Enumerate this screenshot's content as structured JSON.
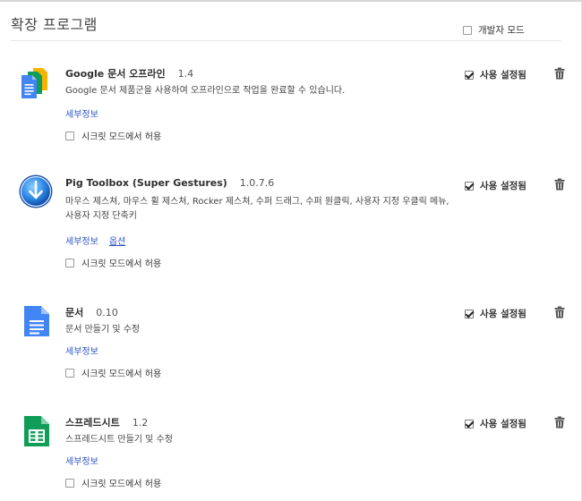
{
  "page": {
    "title": "확장 프로그램",
    "developer_mode": {
      "label": "개발자 모드",
      "checked": false
    }
  },
  "common": {
    "details_label": "세부정보",
    "incognito_label": "시크릿 모드에서 허용",
    "enabled_label": "사용 설정됨"
  },
  "extensions": [
    {
      "name": "Google 문서 오프라인",
      "version": "1.4",
      "description": "Google 문서 제품군을 사용하여 오프라인으로 작업을 완료할 수 있습니다.",
      "icon": "google-docs-offline-icon",
      "enabled": true,
      "incognito": false
    },
    {
      "name": "Pig Toolbox (Super Gestures)",
      "version": "1.0.7.6",
      "description": "마우스 제스쳐, 마우스 휠 제스쳐, Rocker 제스쳐, 수퍼 드래그, 수퍼 원클릭, 사용자 지정 우클릭 메뉴, 사용자 지정 단축키",
      "options_label": "옵션",
      "icon": "pig-toolbox-icon",
      "enabled": true,
      "incognito": false
    },
    {
      "name": "문서",
      "version": "0.10",
      "description": "문서 만들기 및 수정",
      "icon": "docs-icon",
      "enabled": true,
      "incognito": false
    },
    {
      "name": "스프레드시트",
      "version": "1.2",
      "description": "스프레드시트 만들기 및 수정",
      "icon": "sheets-icon",
      "enabled": true,
      "incognito": false
    }
  ],
  "colors": {
    "link": "#2d55c6",
    "docs_blue": "#4285f4",
    "sheets_green": "#0f9d58",
    "slides_yellow": "#f4b400"
  }
}
